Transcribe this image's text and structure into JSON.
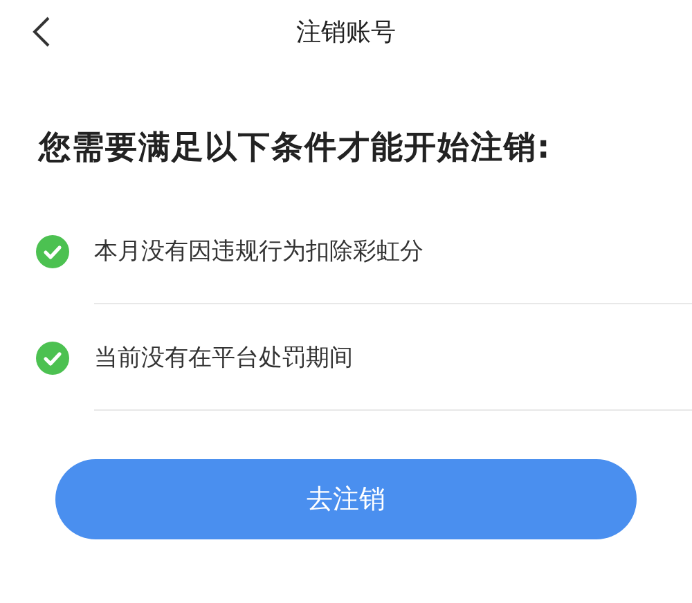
{
  "header": {
    "title": "注销账号"
  },
  "heading": "您需要满足以下条件才能开始注销:",
  "conditions": [
    {
      "text": "本月没有因违规行为扣除彩虹分",
      "checked": true
    },
    {
      "text": "当前没有在平台处罚期间",
      "checked": true
    }
  ],
  "button": {
    "label": "去注销"
  }
}
